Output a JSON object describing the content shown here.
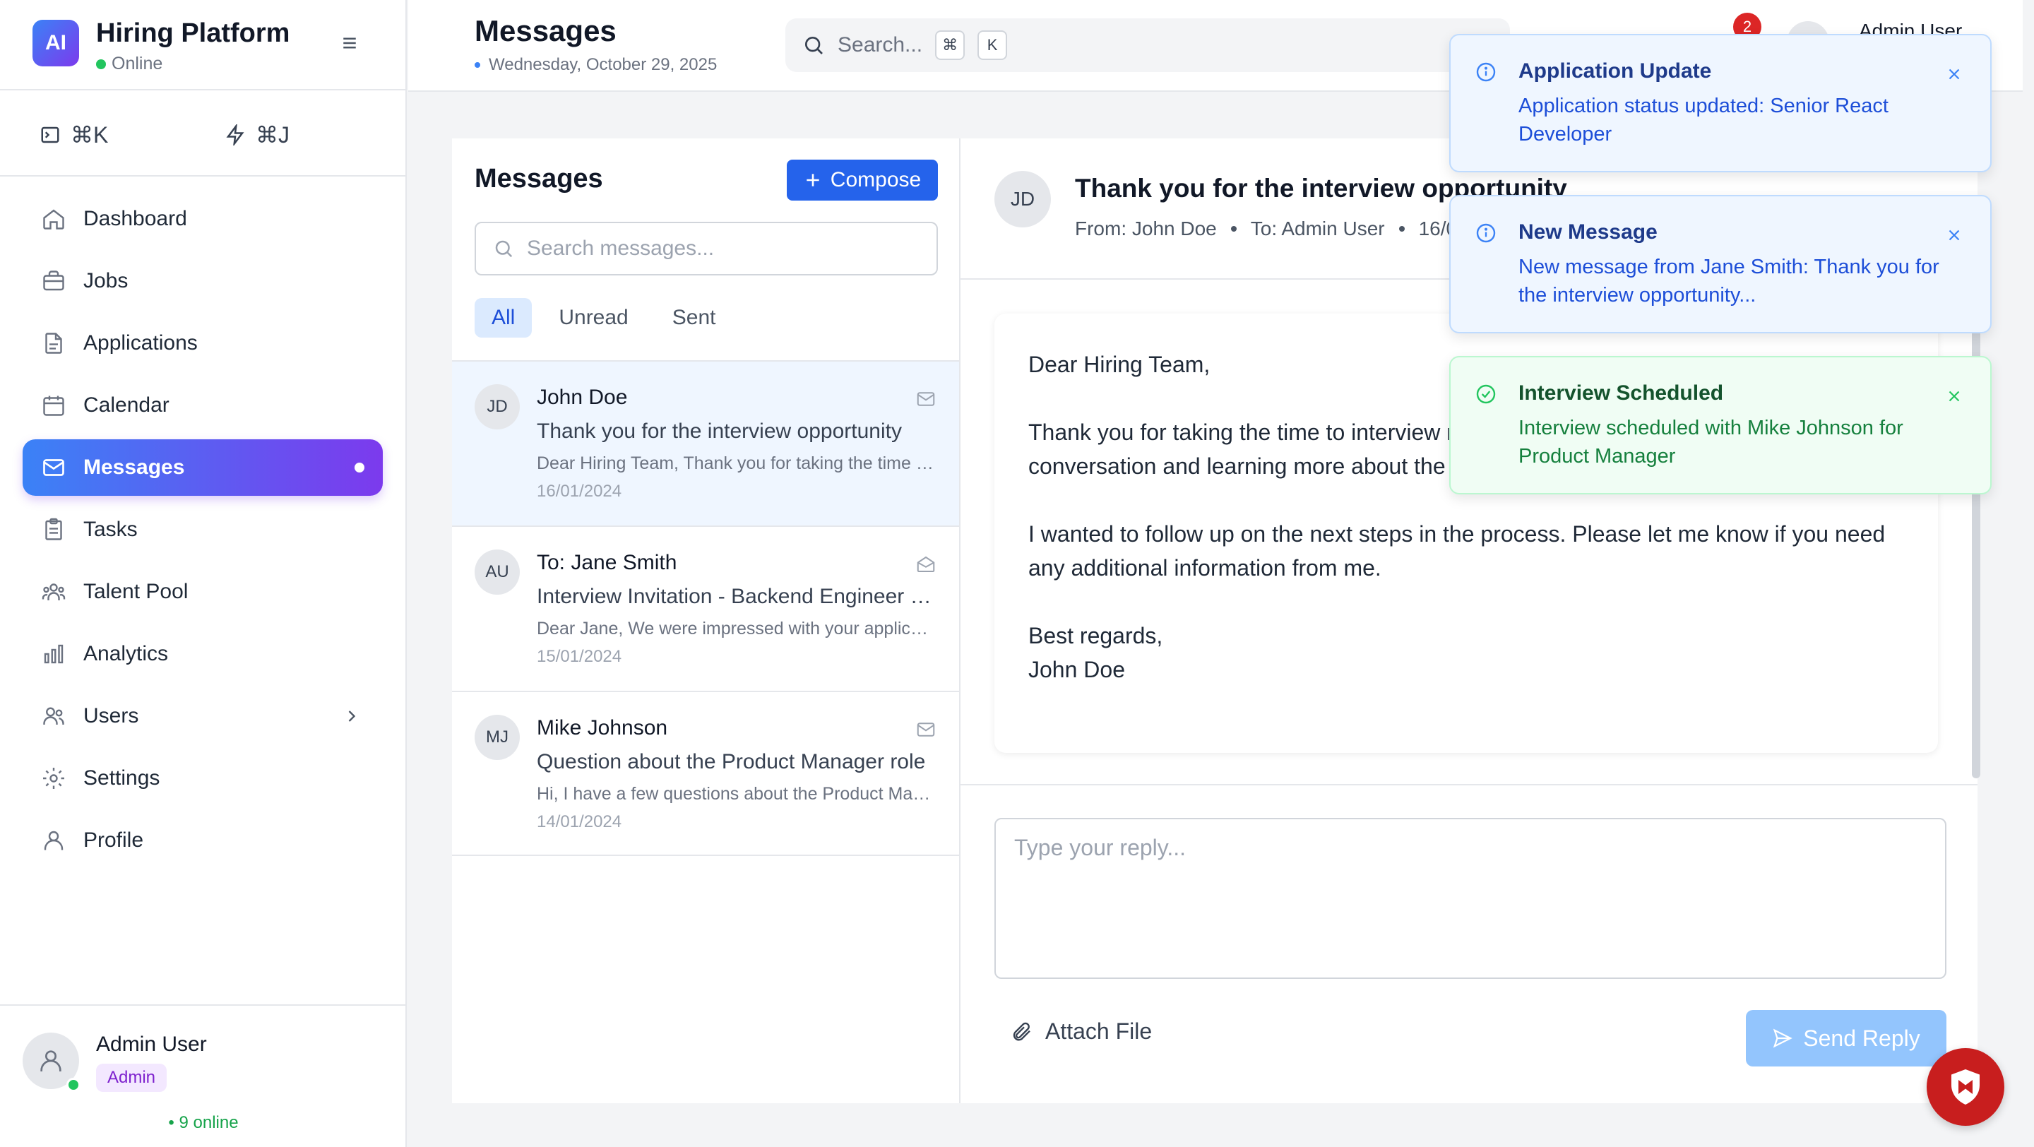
{
  "brand": {
    "logo": "AI",
    "title": "Hiring Platform",
    "status": "Online"
  },
  "quick_actions": [
    {
      "icon": "terminal-icon",
      "label": "⌘K"
    },
    {
      "icon": "lightning-icon",
      "label": "⌘J"
    }
  ],
  "sidebar": {
    "items": [
      {
        "label": "Dashboard",
        "icon": "home-icon"
      },
      {
        "label": "Jobs",
        "icon": "briefcase-icon"
      },
      {
        "label": "Applications",
        "icon": "document-icon"
      },
      {
        "label": "Calendar",
        "icon": "calendar-icon"
      },
      {
        "label": "Messages",
        "icon": "mail-icon",
        "active": true
      },
      {
        "label": "Tasks",
        "icon": "clipboard-icon"
      },
      {
        "label": "Talent Pool",
        "icon": "people-icon"
      },
      {
        "label": "Analytics",
        "icon": "bar-chart-icon"
      },
      {
        "label": "Users",
        "icon": "users-icon"
      },
      {
        "label": "Settings",
        "icon": "gear-icon"
      },
      {
        "label": "Profile",
        "icon": "user-icon"
      }
    ]
  },
  "current_user": {
    "name": "Admin User",
    "role": "Admin",
    "online_count": "9 online"
  },
  "header": {
    "title": "Messages",
    "date": "Wednesday, October 29, 2025",
    "search_placeholder": "Search...",
    "kbd1": "⌘",
    "kbd2": "K",
    "notification_count": "2",
    "user_name": "Admin User"
  },
  "messages_panel": {
    "title": "Messages",
    "compose_label": "Compose",
    "search_placeholder": "Search messages...",
    "filters": [
      "All",
      "Unread",
      "Sent"
    ],
    "active_filter": "All",
    "items": [
      {
        "initials": "JD",
        "from": "John Doe",
        "subject": "Thank you for the interview opportunity",
        "preview": "Dear Hiring Team, Thank you for taking the time to interview me for the position.",
        "date": "16/01/2024",
        "read": false,
        "selected": true
      },
      {
        "initials": "AU",
        "from": "To: Jane Smith",
        "subject": "Interview Invitation - Backend Engineer Position",
        "preview": "Dear Jane, We were impressed with your application and would like to invite you.",
        "date": "15/01/2024",
        "read": true,
        "selected": false
      },
      {
        "initials": "MJ",
        "from": "Mike Johnson",
        "subject": "Question about the Product Manager role",
        "preview": "Hi, I have a few questions about the Product Manager position you posted.",
        "date": "14/01/2024",
        "read": false,
        "selected": false
      }
    ]
  },
  "detail": {
    "initials": "JD",
    "subject": "Thank you for the interview opportunity",
    "from": "From: John Doe",
    "to": "To: Admin User",
    "date": "16/01/2024",
    "body": [
      "Dear Hiring Team,",
      "Thank you for taking the time to interview me for the position. I really enjoyed our conversation and learning more about the team culture.",
      "I wanted to follow up on the next steps in the process. Please let me know if you need any additional information from me.",
      "Best regards,\nJohn Doe"
    ],
    "reply_placeholder": "Type your reply...",
    "attach_label": "Attach File",
    "send_label": "Send Reply"
  },
  "toasts": [
    {
      "type": "info",
      "title": "Application Update",
      "message": "Application status updated: Senior React Developer"
    },
    {
      "type": "info",
      "title": "New Message",
      "message": "New message from Jane Smith: Thank you for the interview opportunity..."
    },
    {
      "type": "success",
      "title": "Interview Scheduled",
      "message": "Interview scheduled with Mike Johnson for Product Manager"
    }
  ],
  "colors": {
    "accent": "#2563eb",
    "gradient_start": "#3b82f6",
    "gradient_end": "#7c3aed",
    "online": "#22c55e",
    "badge": "#dc2626"
  }
}
